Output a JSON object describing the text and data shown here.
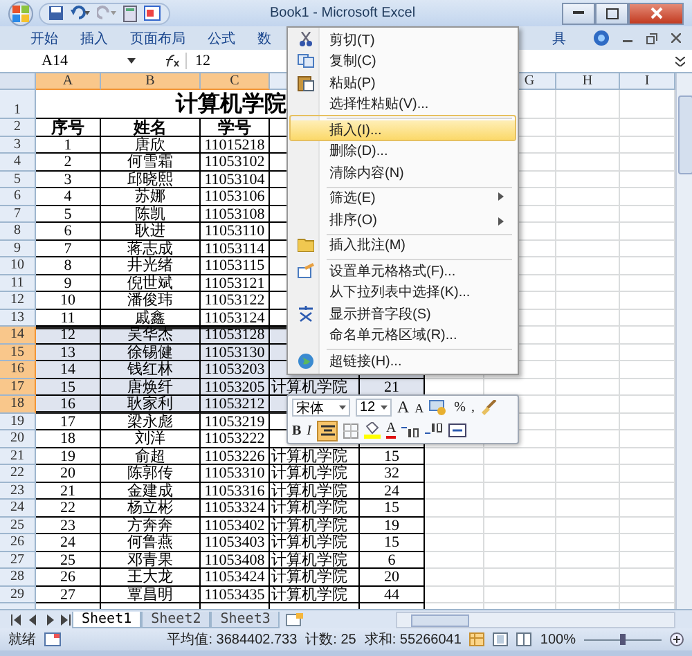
{
  "window": {
    "title": "Book1 - Microsoft Excel"
  },
  "ribbon_tabs": [
    {
      "label": "开始"
    },
    {
      "label": "插入"
    },
    {
      "label": "页面布局"
    },
    {
      "label": "公式"
    },
    {
      "label": "数"
    },
    {
      "label": "具"
    }
  ],
  "name_box": "A14",
  "formula": "12",
  "columns": [
    {
      "label": "A",
      "selected": true
    },
    {
      "label": "B",
      "selected": true
    },
    {
      "label": "C",
      "selected": true
    },
    {
      "label": "G",
      "selected": false
    },
    {
      "label": "H",
      "selected": false
    },
    {
      "label": "I",
      "selected": false
    }
  ],
  "title_row": {
    "number": "1",
    "text": "计算机学院"
  },
  "header_row": {
    "number": "2",
    "cells": [
      "序号",
      "姓名",
      "学号"
    ]
  },
  "rows": [
    {
      "number": "3",
      "cells": [
        "1",
        "唐欣",
        "11015218"
      ],
      "selected": false
    },
    {
      "number": "4",
      "cells": [
        "2",
        "何雪霜",
        "11053102"
      ],
      "selected": false
    },
    {
      "number": "5",
      "cells": [
        "3",
        "邱晓熙",
        "11053104"
      ],
      "selected": false
    },
    {
      "number": "6",
      "cells": [
        "4",
        "苏娜",
        "11053106"
      ],
      "selected": false
    },
    {
      "number": "7",
      "cells": [
        "5",
        "陈凯",
        "11053108"
      ],
      "selected": false
    },
    {
      "number": "8",
      "cells": [
        "6",
        "耿进",
        "11053110"
      ],
      "selected": false
    },
    {
      "number": "9",
      "cells": [
        "7",
        "蒋志成",
        "11053114"
      ],
      "selected": false
    },
    {
      "number": "10",
      "cells": [
        "8",
        "井光绪",
        "11053115"
      ],
      "selected": false
    },
    {
      "number": "11",
      "cells": [
        "9",
        "倪世斌",
        "11053121"
      ],
      "selected": false
    },
    {
      "number": "12",
      "cells": [
        "10",
        "潘俊玮",
        "11053122"
      ],
      "selected": false
    },
    {
      "number": "13",
      "cells": [
        "11",
        "戚鑫",
        "11053124"
      ],
      "selected": false
    },
    {
      "number": "14",
      "cells": [
        "12",
        "吴华杰",
        "11053128"
      ],
      "selected": true
    },
    {
      "number": "15",
      "cells": [
        "13",
        "徐锡健",
        "11053130"
      ],
      "selected": true
    },
    {
      "number": "16",
      "cells": [
        "14",
        "钱红林",
        "11053203"
      ],
      "selected": true
    },
    {
      "number": "17",
      "cells": [
        "15",
        "唐焕纤",
        "11053205"
      ],
      "department": "计算机学院",
      "count": "21",
      "selected": true
    },
    {
      "number": "18",
      "cells": [
        "16",
        "耿家利",
        "11053212"
      ],
      "selected": true
    },
    {
      "number": "19",
      "cells": [
        "17",
        "梁永彪",
        "11053219"
      ],
      "selected": false
    },
    {
      "number": "20",
      "cells": [
        "18",
        "刘洋",
        "11053222"
      ],
      "selected": false
    },
    {
      "number": "21",
      "cells": [
        "19",
        "俞超",
        "11053226"
      ],
      "department": "计算机学院",
      "count": "15",
      "selected": false
    },
    {
      "number": "22",
      "cells": [
        "20",
        "陈郭传",
        "11053310"
      ],
      "department": "计算机学院",
      "count": "32",
      "selected": false
    },
    {
      "number": "23",
      "cells": [
        "21",
        "金建成",
        "11053316"
      ],
      "department": "计算机学院",
      "count": "24",
      "selected": false
    },
    {
      "number": "24",
      "cells": [
        "22",
        "杨立彬",
        "11053324"
      ],
      "department": "计算机学院",
      "count": "15",
      "selected": false
    },
    {
      "number": "25",
      "cells": [
        "23",
        "方奔奔",
        "11053402"
      ],
      "department": "计算机学院",
      "count": "19",
      "selected": false
    },
    {
      "number": "26",
      "cells": [
        "24",
        "何鲁燕",
        "11053403"
      ],
      "department": "计算机学院",
      "count": "15",
      "selected": false
    },
    {
      "number": "27",
      "cells": [
        "25",
        "邓青果",
        "11053408"
      ],
      "department": "计算机学院",
      "count": "6",
      "selected": false
    },
    {
      "number": "28",
      "cells": [
        "26",
        "王大龙",
        "11053424"
      ],
      "department": "计算机学院",
      "count": "20",
      "selected": false
    },
    {
      "number": "29",
      "cells": [
        "27",
        "覃昌明",
        "11053435"
      ],
      "department": "计算机学院",
      "count": "44",
      "selected": false
    }
  ],
  "context_menu": [
    {
      "label": "剪切(T)",
      "selected": false,
      "submenu": false,
      "divider_above": false
    },
    {
      "label": "复制(C)",
      "selected": false,
      "submenu": false,
      "divider_above": false
    },
    {
      "label": "粘贴(P)",
      "selected": false,
      "submenu": false,
      "divider_above": false
    },
    {
      "label": "选择性粘贴(V)...",
      "selected": false,
      "submenu": false,
      "divider_above": false
    },
    {
      "label": "插入(I)...",
      "selected": true,
      "submenu": false,
      "divider_above": true
    },
    {
      "label": "删除(D)...",
      "selected": false,
      "submenu": false,
      "divider_above": false
    },
    {
      "label": "清除内容(N)",
      "selected": false,
      "submenu": false,
      "divider_above": false
    },
    {
      "label": "筛选(E)",
      "selected": false,
      "submenu": true,
      "divider_above": true
    },
    {
      "label": "排序(O)",
      "selected": false,
      "submenu": true,
      "divider_above": false
    },
    {
      "label": "插入批注(M)",
      "selected": false,
      "submenu": false,
      "divider_above": true
    },
    {
      "label": "设置单元格格式(F)...",
      "selected": false,
      "submenu": false,
      "divider_above": true
    },
    {
      "label": "从下拉列表中选择(K)...",
      "selected": false,
      "submenu": false,
      "divider_above": false
    },
    {
      "label": "显示拼音字段(S)",
      "selected": false,
      "submenu": false,
      "divider_above": false
    },
    {
      "label": "命名单元格区域(R)...",
      "selected": false,
      "submenu": false,
      "divider_above": false
    },
    {
      "label": "超链接(H)...",
      "selected": false,
      "submenu": false,
      "divider_above": true
    }
  ],
  "mini_toolbar": {
    "font": "宋体",
    "size": "12",
    "grow": "A",
    "shrink": "A",
    "percent": "%",
    "comma": ",",
    "bold": "B",
    "italic": "I",
    "font_color": "A",
    "center_on": true
  },
  "sheets": [
    {
      "label": "Sheet1",
      "selected": true
    },
    {
      "label": "Sheet2",
      "selected": false
    },
    {
      "label": "Sheet3",
      "selected": false
    }
  ],
  "status": {
    "ready": "就绪",
    "average": "平均值: 3684402.733",
    "count": "计数: 25",
    "sum": "求和: 55266041",
    "zoom": "100%",
    "zoom_slider": {
      "level": 0.5
    }
  }
}
